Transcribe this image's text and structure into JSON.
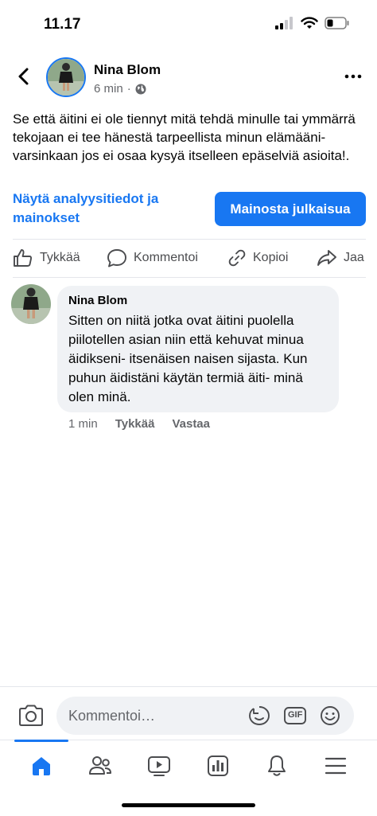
{
  "status_bar": {
    "time": "11.17"
  },
  "post": {
    "author": "Nina Blom",
    "time": "6 min",
    "separator": "·",
    "text": "Se että äitini ei ole tiennyt mitä tehdä minulle tai ymmärrä tekojaan ei tee hänestä tarpeellista minun elämääni- varsinkaan jos ei osaa kysyä itselleen epäselviä asioita!.",
    "insights_link": "Näytä analyysitiedot ja mainokset",
    "promote_button": "Mainosta julkaisua"
  },
  "actions": {
    "like": "Tykkää",
    "comment": "Kommentoi",
    "copy": "Kopioi",
    "share": "Jaa"
  },
  "comment": {
    "author": "Nina Blom",
    "text": "Sitten on niitä jotka ovat äitini puolella piilotellen asian niin että kehuvat minua äidikseni- itsenäisen naisen sijasta. Kun puhun äidistäni käytän termiä äiti- minä olen minä.",
    "time": "1 min",
    "like": "Tykkää",
    "reply": "Vastaa"
  },
  "composer": {
    "placeholder": "Kommentoi…",
    "gif_label": "GIF"
  },
  "nav": {
    "items": [
      "home-icon",
      "friends-icon",
      "video-icon",
      "dashboard-icon",
      "notifications-icon",
      "menu-icon"
    ],
    "active": "home-icon"
  },
  "colors": {
    "accent": "#1877f2",
    "bubble": "#f0f2f5",
    "muted": "#65676b"
  }
}
